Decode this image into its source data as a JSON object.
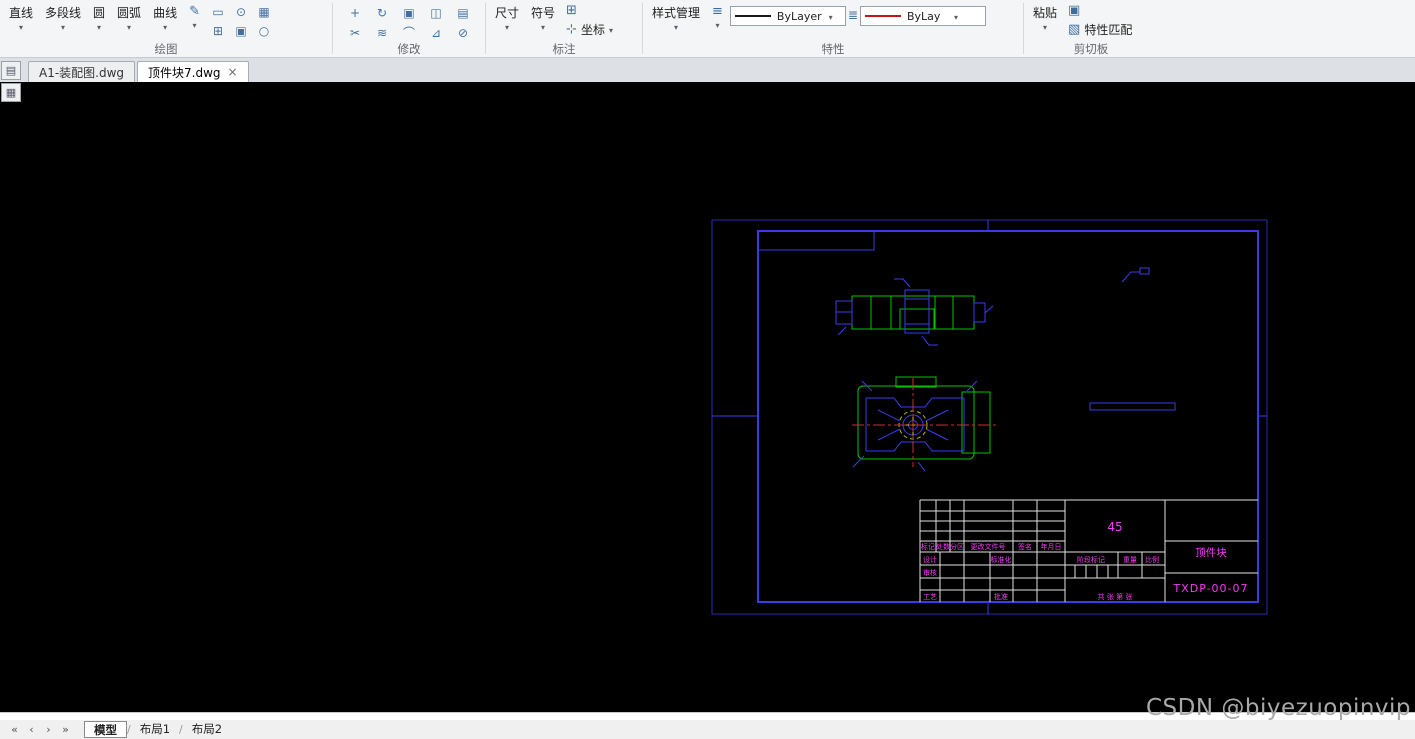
{
  "ribbon": {
    "group_labels": {
      "draw": "绘图",
      "modify": "修改",
      "annotate": "标注",
      "properties": "特性",
      "clipboard": "剪切板"
    },
    "draw_buttons": [
      "直线",
      "多段线",
      "圆",
      "圆弧",
      "曲线"
    ],
    "annotate": {
      "dimension": "尺寸",
      "symbol": "符号",
      "coordinate": "坐标"
    },
    "properties": {
      "style_manager": "样式管理",
      "color_value": "ByLayer",
      "linetype_value": "ByLay"
    },
    "clipboard": {
      "paste": "粘贴",
      "match": "特性匹配"
    }
  },
  "file_tabs": [
    "A1-装配图.dwg",
    "顶件块7.dwg"
  ],
  "drawing": {
    "material": "45",
    "part_name": "顶件块",
    "drawing_no": "TXDP-00-07",
    "title_block": {
      "mark": "标记",
      "count": "处数",
      "zone": "分区",
      "change_no": "更改文件号",
      "signature": "签名",
      "date": "年月日",
      "design": "设计",
      "standardization": "标准化",
      "stage": "阶段标记",
      "weight": "重量",
      "scale": "比例",
      "check": "审核",
      "process": "工艺",
      "approve": "批准",
      "sheets": "共 张 第 张"
    }
  },
  "status_bar": {
    "tabs": [
      "模型",
      "布局1",
      "布局2"
    ]
  },
  "watermark": "CSDN @biyezuopinvip"
}
